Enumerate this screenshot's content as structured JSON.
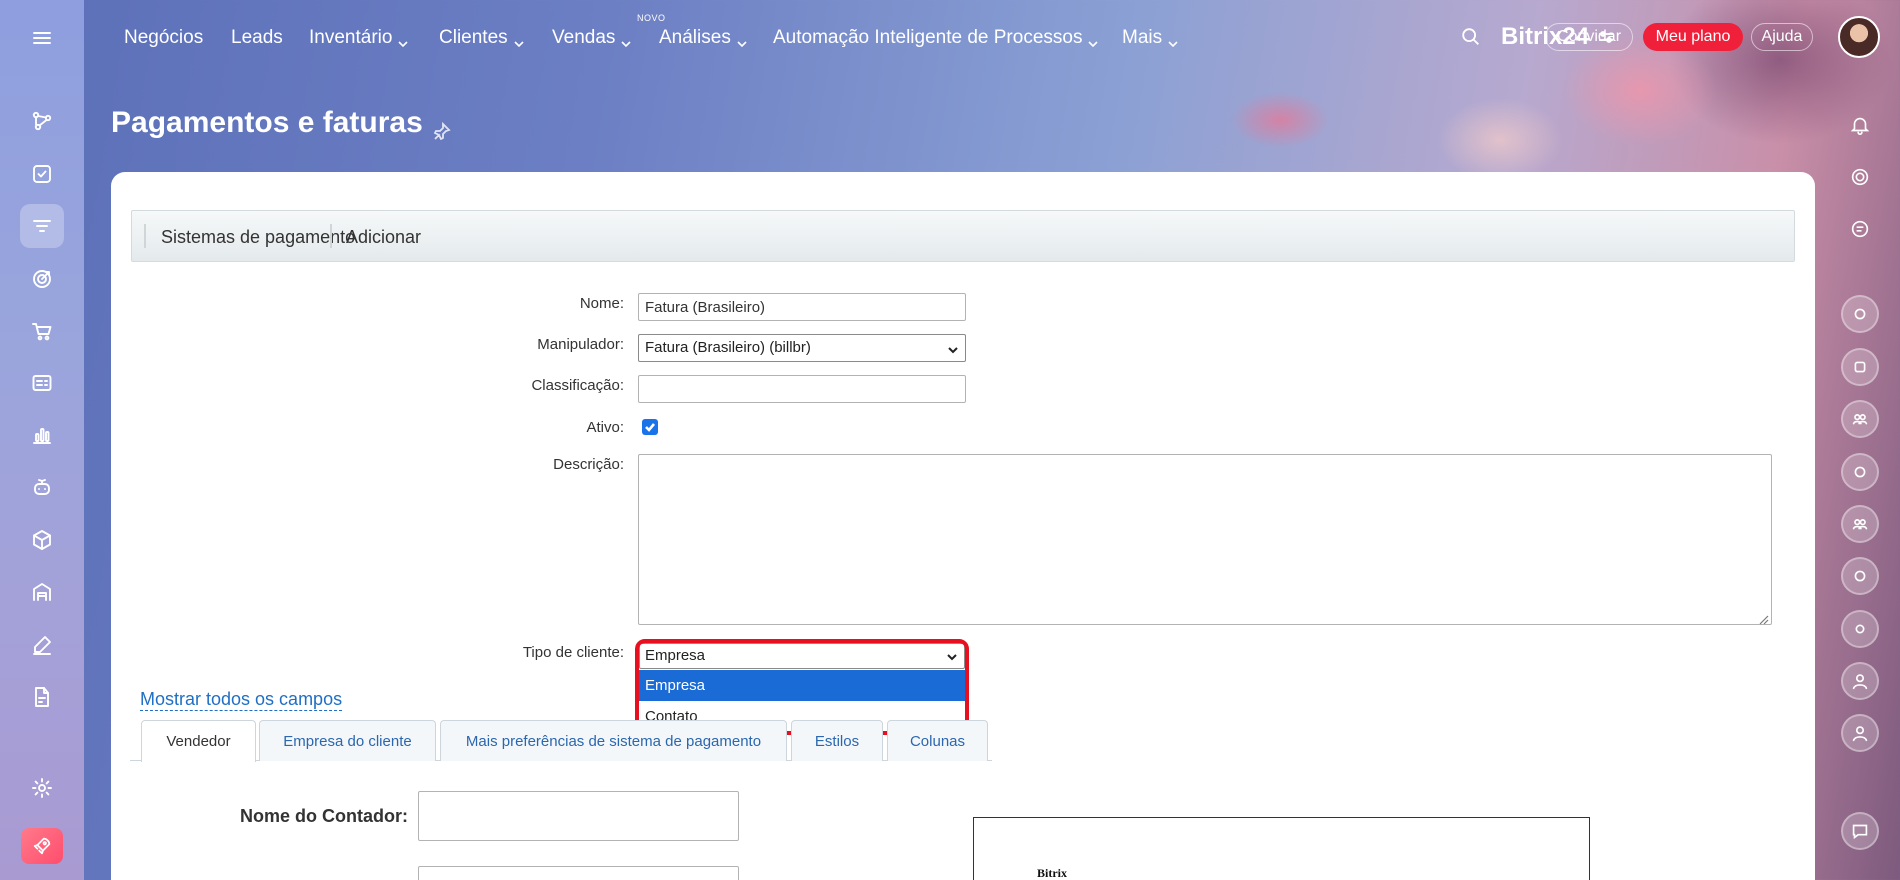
{
  "nav": {
    "items": [
      "Negócios",
      "Leads",
      "Inventário",
      "Clientes",
      "Vendas",
      "Análises",
      "Automação Inteligente de Processos",
      "Mais"
    ],
    "new_badge": "NOVO",
    "brand": "Bitrix24",
    "invite": "Convidar",
    "plan": "Meu plano",
    "help": "Ajuda"
  },
  "sidebar_icons": [
    "flow-icon",
    "task-check-icon",
    "crm-filter-icon",
    "target-icon",
    "cart-icon",
    "contact-card-icon",
    "analytics-bars-icon",
    "robot-icon",
    "box-icon",
    "warehouse-icon",
    "sign-pen-icon",
    "document-edit-icon",
    "settings-gear-icon",
    "rocket-icon"
  ],
  "page": {
    "title": "Pagamentos e faturas"
  },
  "toolbar": {
    "payment_systems": "Sistemas de pagamento",
    "add": "Adicionar"
  },
  "form": {
    "name_label": "Nome:",
    "name_value": "Fatura (Brasileiro)",
    "handler_label": "Manipulador:",
    "handler_value": "Fatura (Brasileiro) (billbr)",
    "sort_label": "Classificação:",
    "sort_value": "",
    "active_label": "Ativo:",
    "active_checked": true,
    "description_label": "Descrição:",
    "client_type_label": "Tipo de cliente:",
    "client_type_value": "Empresa",
    "client_type_options": [
      "Empresa",
      "Contato"
    ]
  },
  "show_all_fields": "Mostrar todos os campos",
  "tabs": [
    "Vendedor",
    "Empresa do cliente",
    "Mais preferências de sistema de pagamento",
    "Estilos",
    "Colunas"
  ],
  "vendor": {
    "accountant_label": "Nome do Contador:"
  },
  "preview": {
    "company": "Bitrix"
  },
  "colors": {
    "accent_blue": "#1a6bd6",
    "plan_red": "#f0203a",
    "highlight_red": "#e8101e"
  }
}
